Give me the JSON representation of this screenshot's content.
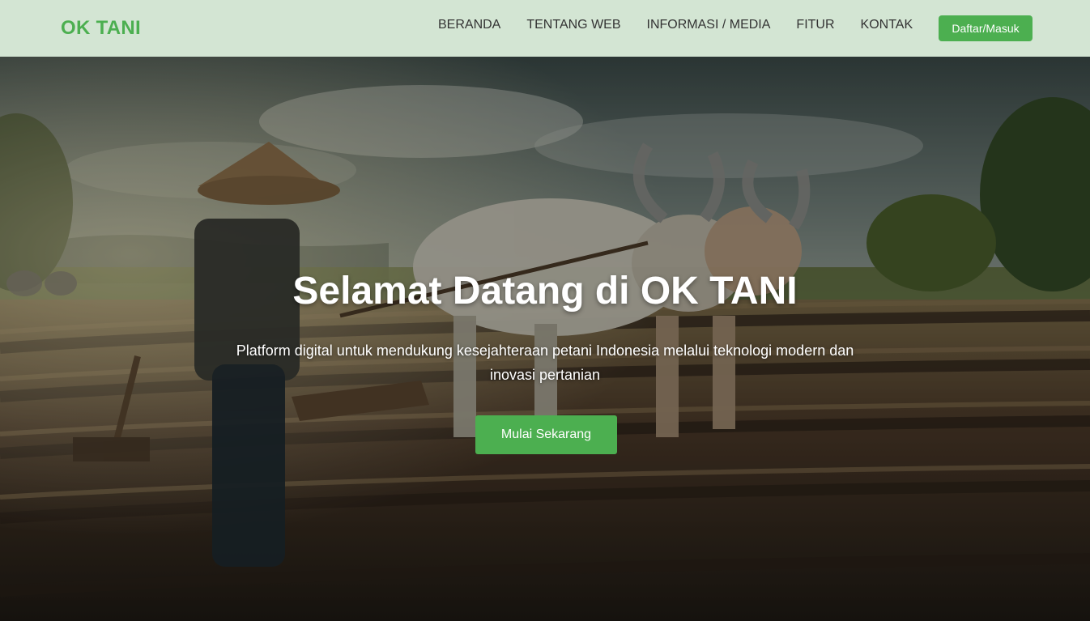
{
  "navbar": {
    "brand": "OK TANI",
    "links": [
      {
        "label": "BERANDA"
      },
      {
        "label": "TENTANG WEB"
      },
      {
        "label": "INFORMASI / MEDIA"
      },
      {
        "label": "FITUR"
      },
      {
        "label": "KONTAK"
      }
    ],
    "cta_label": "Daftar/Masuk"
  },
  "hero": {
    "title": "Selamat Datang di OK TANI",
    "subtitle": "Platform digital untuk mendukung kesejahteraan petani Indonesia melalui teknologi modern dan inovasi pertanian",
    "cta_label": "Mulai Sekarang",
    "background_image": "farmer plowing field with oxen"
  },
  "colors": {
    "navbar_bg": "#d3e5d3",
    "brand": "#4caf50",
    "accent": "#4caf50",
    "nav_text": "#333333"
  }
}
